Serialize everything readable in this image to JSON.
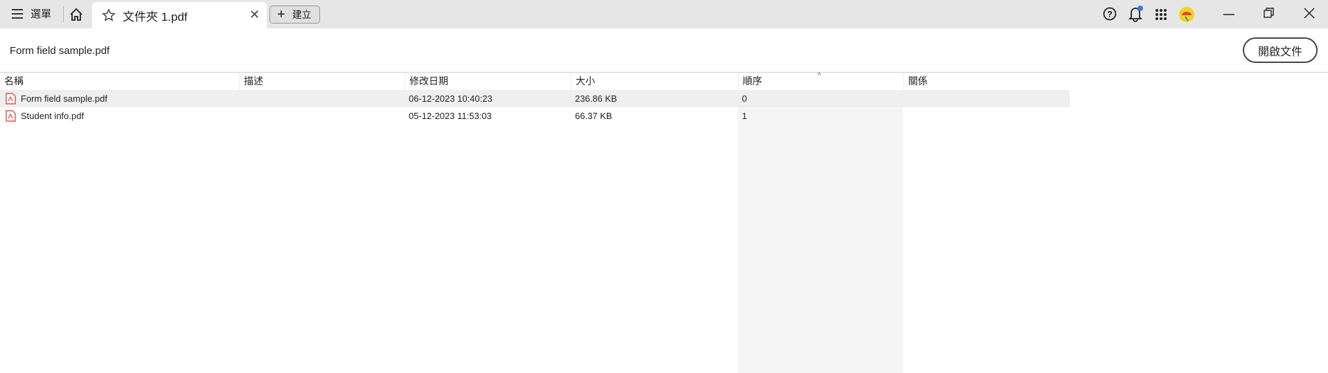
{
  "tabbar": {
    "menu_label": "選單",
    "tab_title": "文件夾 1.pdf",
    "new_label": "建立"
  },
  "header": {
    "title": "Form field sample.pdf",
    "open_button": "開啟文件"
  },
  "table": {
    "columns": [
      "名稱",
      "描述",
      "修改日期",
      "大小",
      "順序",
      "關係"
    ],
    "sorted_column": "順序",
    "rows": [
      {
        "name": "Form field sample.pdf",
        "description": "",
        "modified": "06-12-2023 10:40:23",
        "size": "236.86 KB",
        "order": "0",
        "relation": ""
      },
      {
        "name": "Student info.pdf",
        "description": "",
        "modified": "05-12-2023 11:53:03",
        "size": "66.37 KB",
        "order": "1",
        "relation": ""
      }
    ]
  },
  "colors": {
    "notification_dot": "#3b7de0",
    "pdf_icon": "#d9342b"
  }
}
